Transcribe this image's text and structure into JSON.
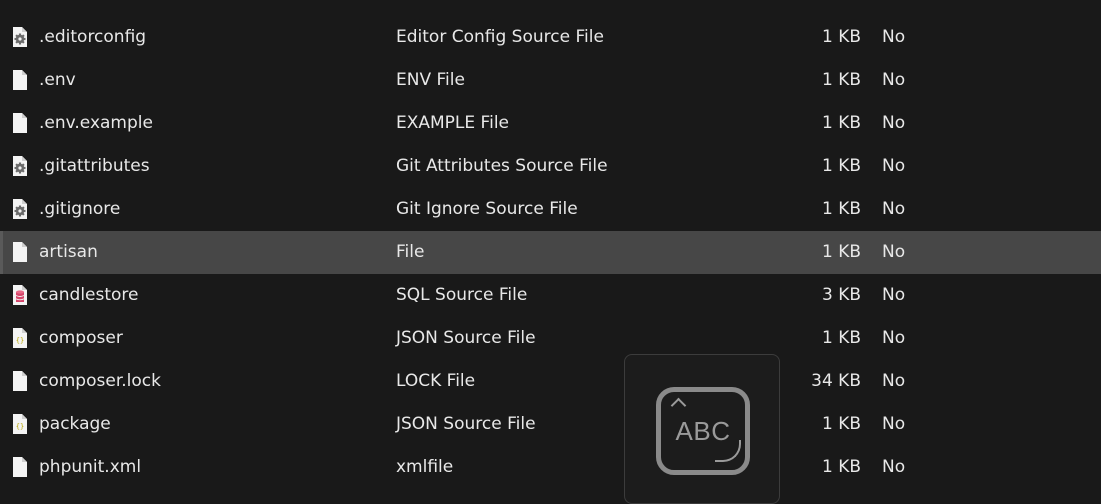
{
  "files": [
    {
      "name": ".editorconfig",
      "type": "Editor Config Source File",
      "size": "1 KB",
      "flag": "No",
      "icon": "config-file-icon"
    },
    {
      "name": ".env",
      "type": "ENV File",
      "size": "1 KB",
      "flag": "No",
      "icon": "blank-file-icon"
    },
    {
      "name": ".env.example",
      "type": "EXAMPLE File",
      "size": "1 KB",
      "flag": "No",
      "icon": "blank-file-icon"
    },
    {
      "name": ".gitattributes",
      "type": "Git Attributes Source File",
      "size": "1 KB",
      "flag": "No",
      "icon": "config-file-icon"
    },
    {
      "name": ".gitignore",
      "type": "Git Ignore Source File",
      "size": "1 KB",
      "flag": "No",
      "icon": "config-file-icon"
    },
    {
      "name": "artisan",
      "type": "File",
      "size": "1 KB",
      "flag": "No",
      "icon": "blank-file-icon",
      "selected": true
    },
    {
      "name": "candlestore",
      "type": "SQL Source File",
      "size": "3 KB",
      "flag": "No",
      "icon": "database-file-icon"
    },
    {
      "name": "composer",
      "type": "JSON Source File",
      "size": "1 KB",
      "flag": "No",
      "icon": "json-file-icon"
    },
    {
      "name": "composer.lock",
      "type": "LOCK File",
      "size": "34 KB",
      "flag": "No",
      "icon": "blank-file-icon"
    },
    {
      "name": "package",
      "type": "JSON Source File",
      "size": "1 KB",
      "flag": "No",
      "icon": "json-file-icon"
    },
    {
      "name": "phpunit.xml",
      "type": "xmlfile",
      "size": "1 KB",
      "flag": "No",
      "icon": "blank-file-icon"
    }
  ],
  "ime_indicator": {
    "label": "ABC",
    "icon": "keyboard-abc-icon"
  },
  "colors": {
    "background": "#191919",
    "selected_row": "#474747",
    "text": "#e8e8e8"
  }
}
